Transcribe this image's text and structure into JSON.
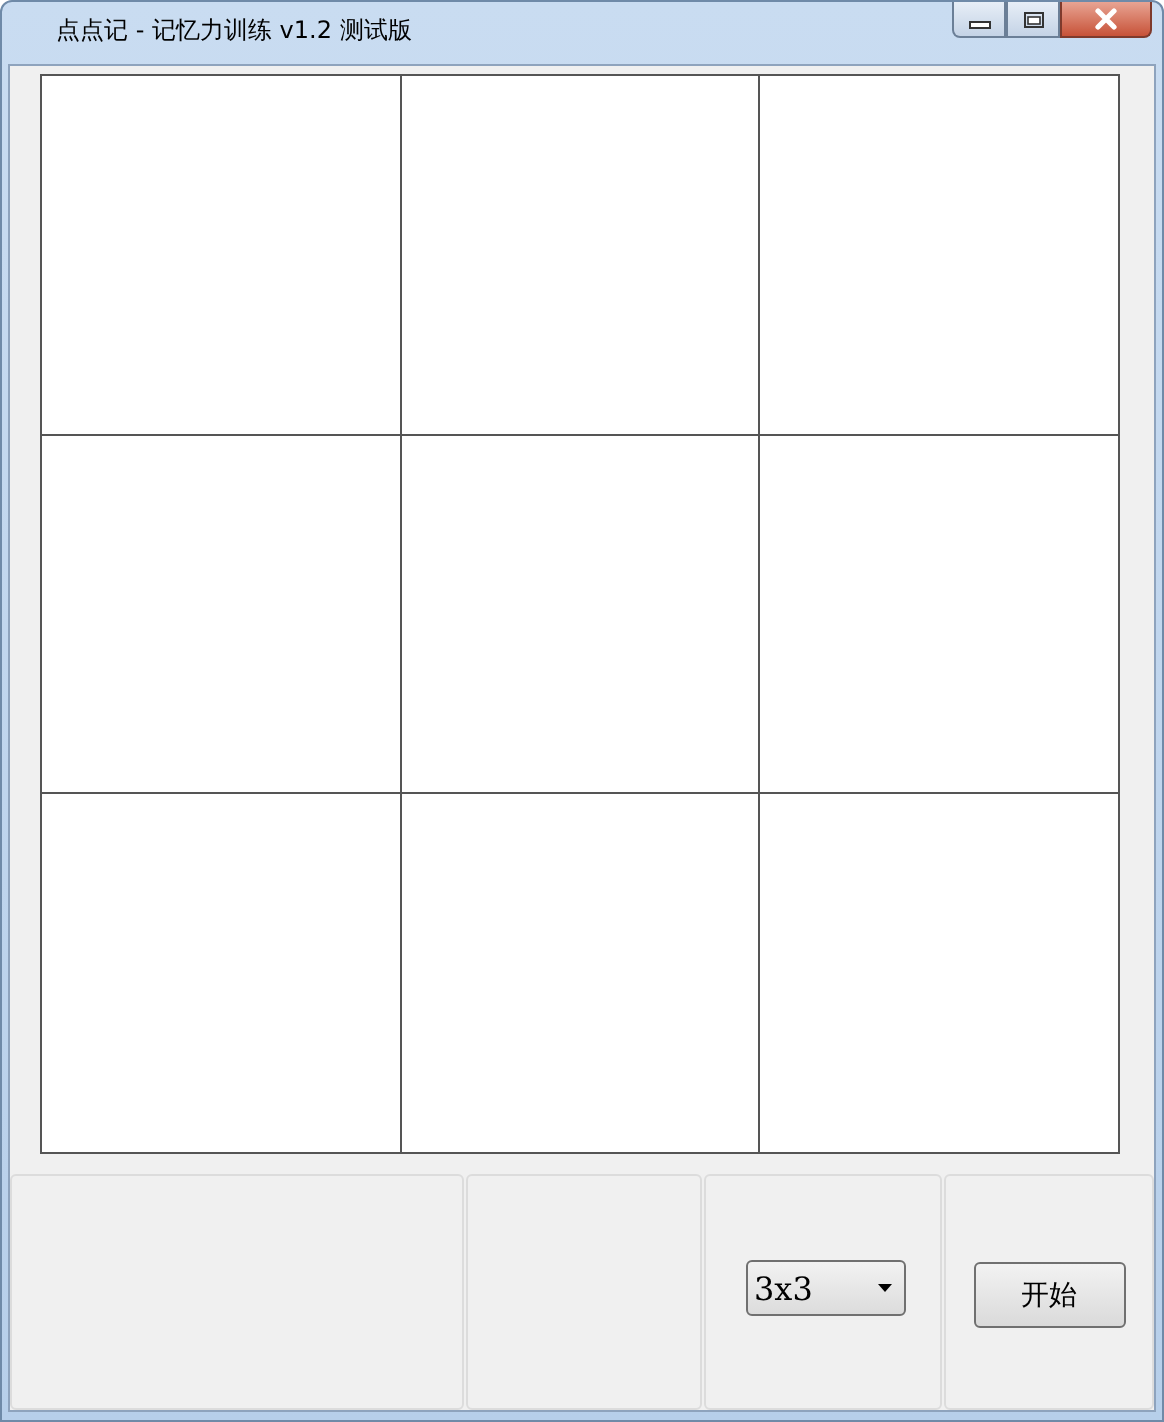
{
  "window": {
    "title": "点点记 - 记忆力训练 v1.2 测试版"
  },
  "board": {
    "rows": [
      {
        "cells": [
          {
            "kind": "blank"
          },
          {
            "kind": "blank"
          },
          {
            "kind": "blank"
          }
        ]
      },
      {
        "cells": [
          {
            "kind": "blank"
          },
          {
            "kind": "blank"
          },
          {
            "kind": "blank"
          }
        ]
      },
      {
        "cells": [
          {
            "kind": "blank"
          },
          {
            "kind": "blank"
          },
          {
            "kind": "blank"
          }
        ]
      }
    ]
  },
  "controls": {
    "size_select": {
      "value": "3x3"
    },
    "start_button": {
      "label": "开始"
    }
  }
}
